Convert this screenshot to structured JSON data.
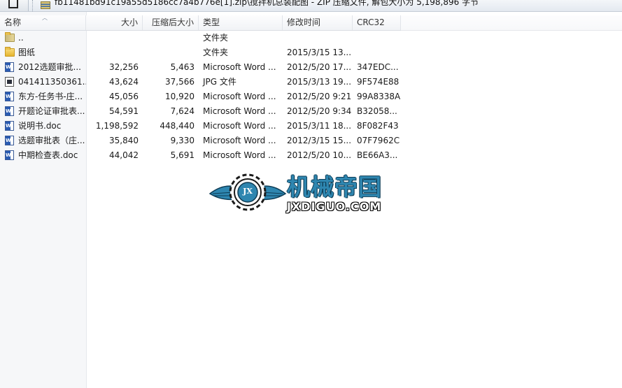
{
  "toolbar": {
    "path": "fb11481bd91c19a55d5186cc7a4b776e[1].zip\\搅拌机总装配图 - ZIP 压缩文件, 解包大小为 5,198,896 字节"
  },
  "columns": {
    "name": "名称",
    "size": "大小",
    "packed": "压缩后大小",
    "type": "类型",
    "modified": "修改时间",
    "crc": "CRC32"
  },
  "rows": [
    {
      "name": "..",
      "size": "",
      "packed": "",
      "type": "文件夹",
      "modified": "",
      "crc": "",
      "icon": "parent-folder-icon"
    },
    {
      "name": "图纸",
      "size": "",
      "packed": "",
      "type": "文件夹",
      "modified": "2015/3/15 13...",
      "crc": "",
      "icon": "folder-icon"
    },
    {
      "name": "2012选题审批...",
      "size": "32,256",
      "packed": "5,463",
      "type": "Microsoft Word ...",
      "modified": "2012/5/20 17...",
      "crc": "347EDC...",
      "icon": "word-doc-icon"
    },
    {
      "name": "041411350361...",
      "size": "43,624",
      "packed": "37,566",
      "type": "JPG 文件",
      "modified": "2015/3/13 19...",
      "crc": "9F574E88",
      "icon": "jpg-file-icon"
    },
    {
      "name": "东方-任务书-庄...",
      "size": "45,056",
      "packed": "10,920",
      "type": "Microsoft Word ...",
      "modified": "2012/5/20 9:21",
      "crc": "99A8338A",
      "icon": "word-doc-icon"
    },
    {
      "name": "开题论证审批表...",
      "size": "54,591",
      "packed": "7,624",
      "type": "Microsoft Word ...",
      "modified": "2012/5/20 9:34",
      "crc": "B32058...",
      "icon": "word-doc-icon"
    },
    {
      "name": "说明书.doc",
      "size": "1,198,592",
      "packed": "448,440",
      "type": "Microsoft Word ...",
      "modified": "2015/3/11 18...",
      "crc": "8F082F43",
      "icon": "word-doc-icon"
    },
    {
      "name": "选题审批表（庄...",
      "size": "35,840",
      "packed": "9,330",
      "type": "Microsoft Word ...",
      "modified": "2012/3/15 15...",
      "crc": "07F7962C",
      "icon": "word-doc-icon"
    },
    {
      "name": "中期检查表.doc",
      "size": "44,042",
      "packed": "5,691",
      "type": "Microsoft Word ...",
      "modified": "2012/5/20 10...",
      "crc": "BE66A3...",
      "icon": "word-doc-icon"
    }
  ],
  "watermark": {
    "title": "机械帝国",
    "domain": "JXDIGUO.COM",
    "badge": "JX"
  },
  "colors": {
    "logo_blue": "#2e86b0",
    "header_bg": "#f1f3f6"
  }
}
